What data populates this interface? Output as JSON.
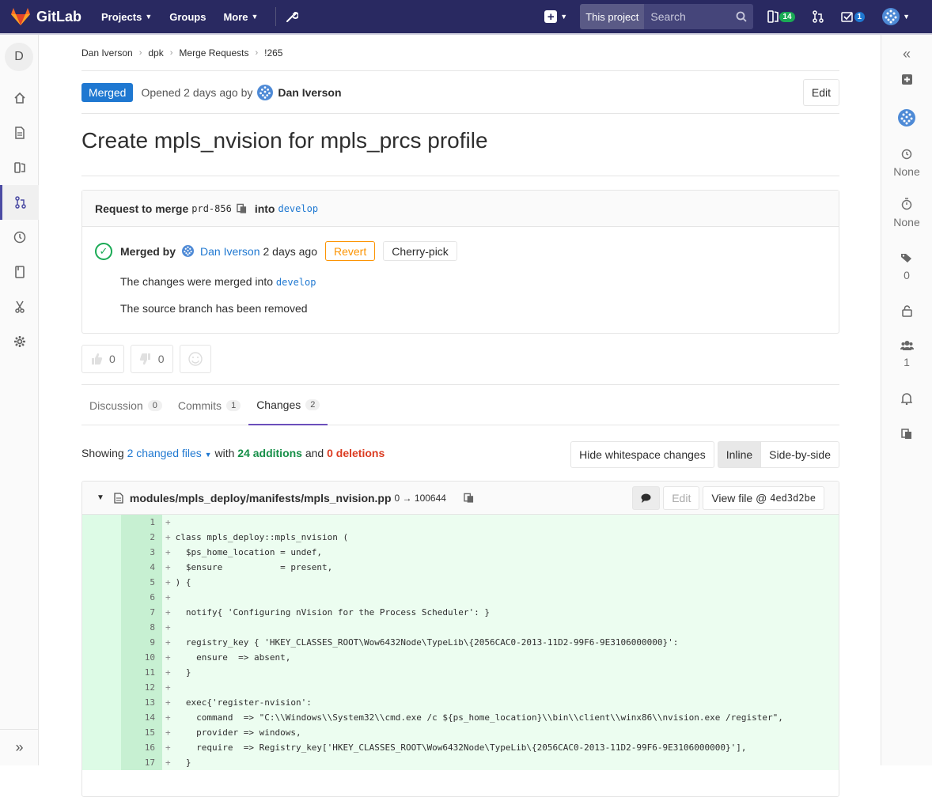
{
  "nav": {
    "logo_text": "GitLab",
    "projects": "Projects",
    "groups": "Groups",
    "more": "More",
    "scope": "This project",
    "search_placeholder": "Search",
    "issues_count": "14",
    "todos_count": "1"
  },
  "sidebar": {
    "project_initial": "D"
  },
  "breadcrumb": [
    "Dan Iverson",
    "dpk",
    "Merge Requests",
    "!265"
  ],
  "header": {
    "status": "Merged",
    "opened_text": "Opened 2 days ago by",
    "author": "Dan Iverson",
    "edit": "Edit"
  },
  "title": "Create mpls_nvision for mpls_prcs profile",
  "merge_request": {
    "request_to_merge": "Request to merge",
    "source_branch": "prd-856",
    "into": "into",
    "target_branch": "develop",
    "merged_by": "Merged by",
    "merged_by_user": "Dan Iverson",
    "merged_when": "2 days ago",
    "revert": "Revert",
    "cherry_pick": "Cherry-pick",
    "merged_into_text": "The changes were merged into",
    "merged_into_branch": "develop",
    "source_removed": "The source branch has been removed"
  },
  "awards": {
    "thumbsup": "0",
    "thumbsdown": "0"
  },
  "tabs": [
    {
      "label": "Discussion",
      "count": "0"
    },
    {
      "label": "Commits",
      "count": "1"
    },
    {
      "label": "Changes",
      "count": "2"
    }
  ],
  "changes": {
    "showing": "Showing",
    "changed_files": "2 changed files",
    "with": "with",
    "additions": "24 additions",
    "and": "and",
    "deletions": "0 deletions",
    "hide_whitespace": "Hide whitespace changes",
    "inline": "Inline",
    "side_by_side": "Side-by-side"
  },
  "file": {
    "path": "modules/mpls_deploy/manifests/mpls_nvision.pp",
    "mode": "0 → 100644",
    "edit": "Edit",
    "view_file": "View file @",
    "sha": "4ed3d2be"
  },
  "right_sidebar": {
    "milestone": "None",
    "time_tracking": "None",
    "labels": "0",
    "participants": "1"
  },
  "code_lines": [
    {
      "n": "1",
      "text": ""
    },
    {
      "n": "2",
      "text": "class mpls_deploy::mpls_nvision ("
    },
    {
      "n": "3",
      "text": "  $ps_home_location = undef,"
    },
    {
      "n": "4",
      "text": "  $ensure           = present,"
    },
    {
      "n": "5",
      "text": ") {"
    },
    {
      "n": "6",
      "text": ""
    },
    {
      "n": "7",
      "text": "  notify{ 'Configuring nVision for the Process Scheduler': }"
    },
    {
      "n": "8",
      "text": ""
    },
    {
      "n": "9",
      "text": "  registry_key { 'HKEY_CLASSES_ROOT\\Wow6432Node\\TypeLib\\{2056CAC0-2013-11D2-99F6-9E3106000000}':"
    },
    {
      "n": "10",
      "text": "    ensure  => absent,"
    },
    {
      "n": "11",
      "text": "  }"
    },
    {
      "n": "12",
      "text": ""
    },
    {
      "n": "13",
      "text": "  exec{'register-nvision':"
    },
    {
      "n": "14",
      "text": "    command  => \"C:\\\\Windows\\\\System32\\\\cmd.exe /c ${ps_home_location}\\\\bin\\\\client\\\\winx86\\\\nvision.exe /register\","
    },
    {
      "n": "15",
      "text": "    provider => windows,"
    },
    {
      "n": "16",
      "text": "    require  => Registry_key['HKEY_CLASSES_ROOT\\Wow6432Node\\TypeLib\\{2056CAC0-2013-11D2-99F6-9E3106000000}'],"
    },
    {
      "n": "17",
      "text": "  }"
    }
  ]
}
